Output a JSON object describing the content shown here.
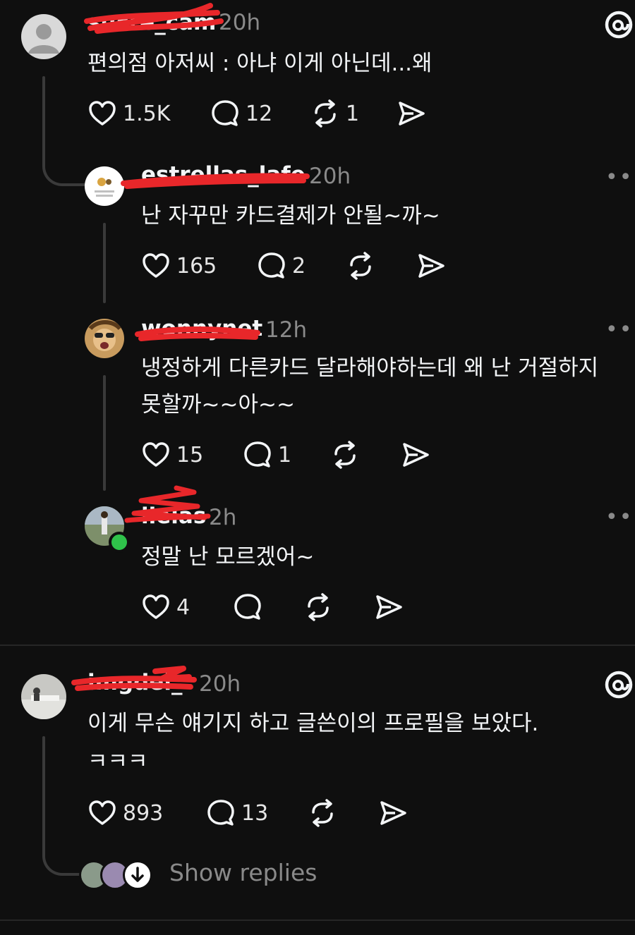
{
  "posts": [
    {
      "username": "sucre_cam",
      "time": "20h",
      "text_lines": [
        "편의점 아저씨 : 아냐 이게 아닌데...왜"
      ],
      "likes": "1.5K",
      "comments": "12",
      "reposts": "1"
    },
    {
      "username": "estrellas_lafe",
      "time": "20h",
      "text_lines": [
        "난 자꾸만 카드결제가 안될~까~"
      ],
      "likes": "165",
      "comments": "2",
      "reposts": ""
    },
    {
      "username": "wonnynet",
      "time": "12h",
      "text_lines": [
        "냉정하게 다른카드 달라해야하는데 왜 난 거절하지",
        "못할까~~아~~"
      ],
      "likes": "15",
      "comments": "1",
      "reposts": ""
    },
    {
      "username": "ilelas",
      "time": "2h",
      "text_lines": [
        "정말 난 모르겠어~"
      ],
      "likes": "4",
      "comments": "",
      "reposts": ""
    },
    {
      "username": "imgdel_",
      "time": "20h",
      "text_lines": [
        "이게 무슨 얘기지 하고 글쓴이의 프로필을 보았다.",
        "ㅋㅋㅋ"
      ],
      "likes": "893",
      "comments": "13",
      "reposts": ""
    }
  ],
  "more_label": "•••",
  "show_replies": "Show replies",
  "colors": {
    "background": "#0f0f0f",
    "text": "#f3f5f7",
    "muted": "#8a8a8a",
    "redaction": "#e8272a"
  },
  "icons": [
    "heart-icon",
    "comment-icon",
    "repost-icon",
    "share-icon",
    "threads-logo-icon",
    "more-icon",
    "down-arrow-icon"
  ]
}
